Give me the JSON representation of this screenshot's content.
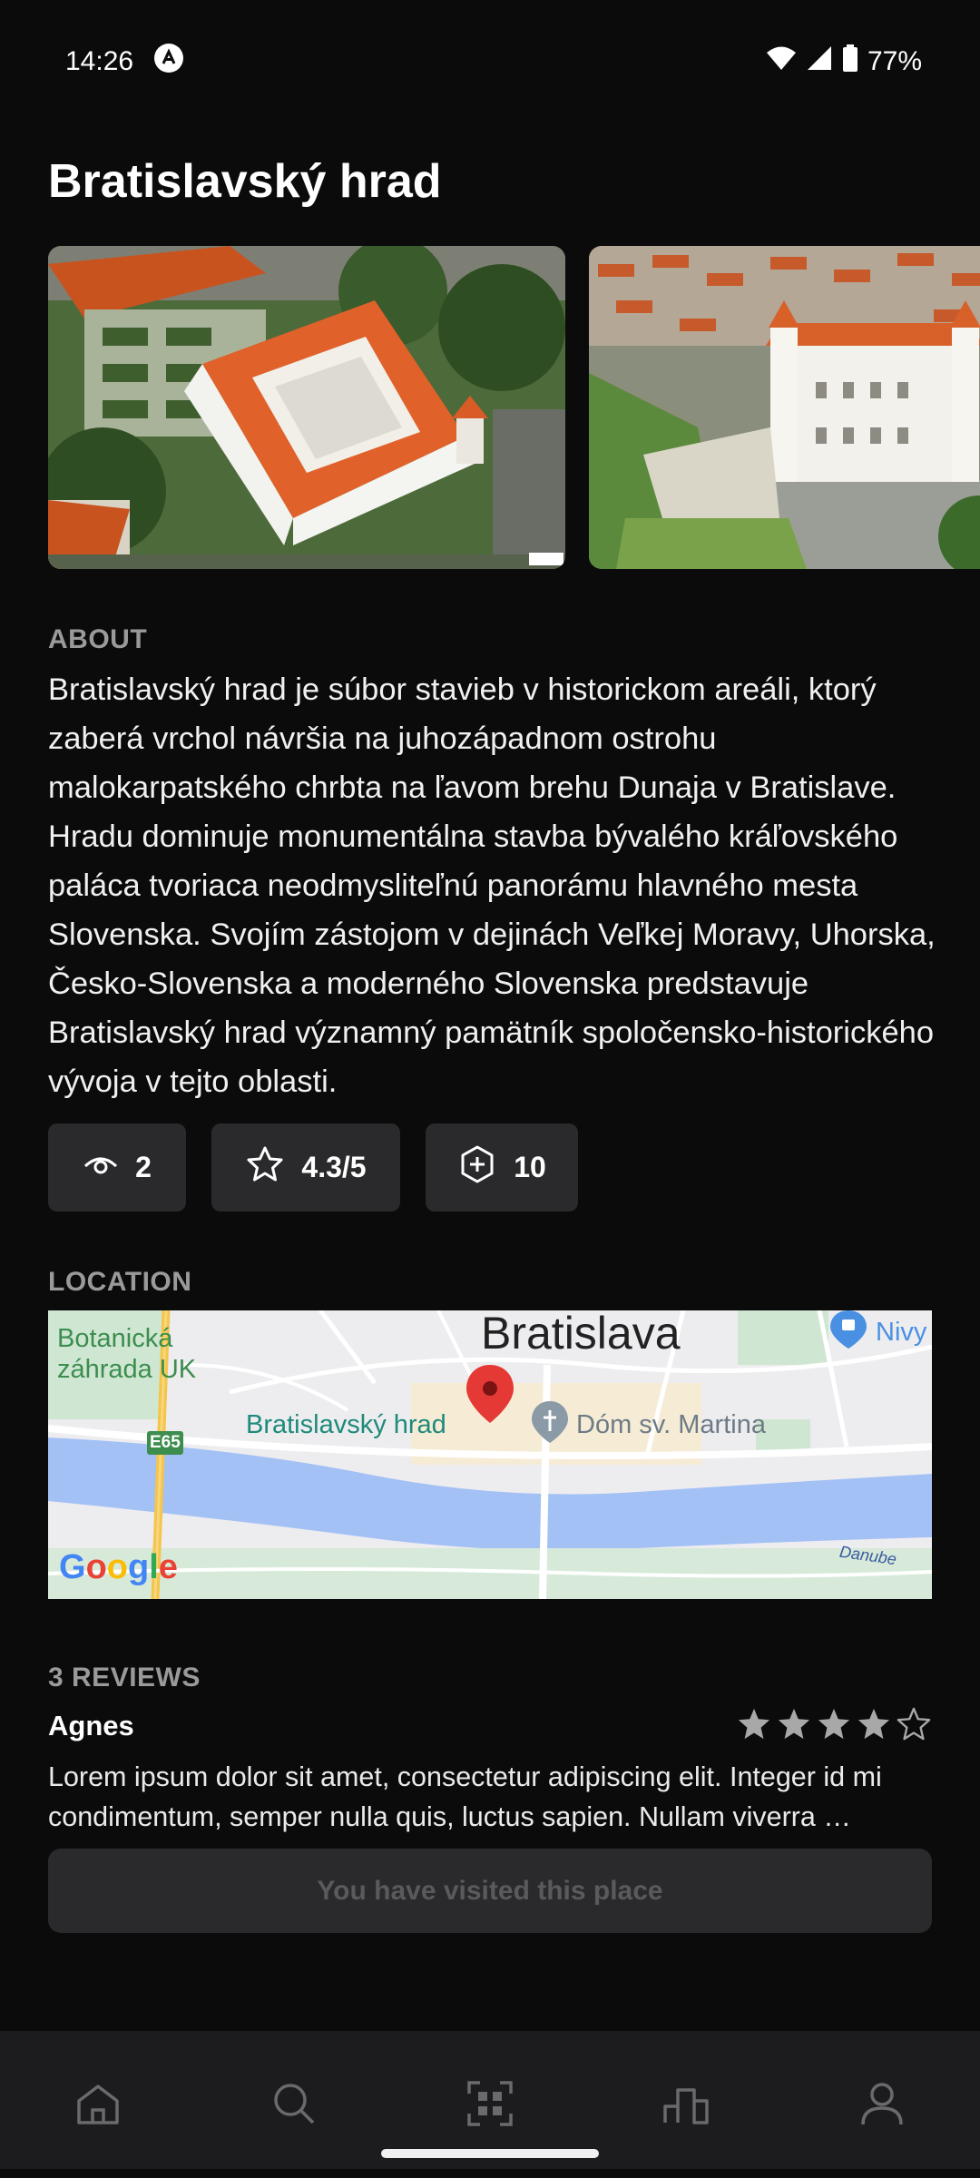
{
  "status": {
    "time": "14:26",
    "battery": "77%"
  },
  "place": {
    "title": "Bratislavský hrad"
  },
  "about": {
    "label": "ABOUT",
    "text": "Bratislavský hrad je súbor stavieb v historickom areáli, ktorý zaberá vrchol návršia na juhozápadnom ostrohu malokarpatského chrbta na ľavom brehu Dunaja v Bratislave. Hradu dominuje monumentálna stavba bývalého kráľovského paláca tvoriaca neodmysliteľnú panorámu hlavného mesta Slovenska. Svojím zástojom v dejinách Veľkej Moravy, Uhorska, Česko-Slovenska a moderného Slovenska predstavuje Bratislavský hrad významný pamätník spoločensko-historického vývoja v tejto oblasti."
  },
  "stats": {
    "views": "2",
    "rating": "4.3/5",
    "points": "10"
  },
  "location": {
    "label": "LOCATION",
    "map": {
      "city": "Bratislava",
      "garden_line1": "Botanická",
      "garden_line2": "záhrada UK",
      "castle": "Bratislavský hrad",
      "cathedral": "Dóm sv. Martina",
      "nivy": "Nivy",
      "road": "E65",
      "river": "Danube",
      "google": "Google"
    }
  },
  "reviews": {
    "label": "3 REVIEWS",
    "items": [
      {
        "author": "Agnes",
        "stars": 4,
        "text": "Lorem ipsum dolor sit amet, consectetur adipiscing elit. Integer id mi condimentum, semper nulla quis, luctus sapien. Nullam viverra …"
      }
    ]
  },
  "visited_button": "You have visited this place",
  "colors": {
    "background": "#0b0b0c",
    "card": "#2a2a2c",
    "star": "#a8a8a8",
    "map_pin": "#e53935"
  }
}
